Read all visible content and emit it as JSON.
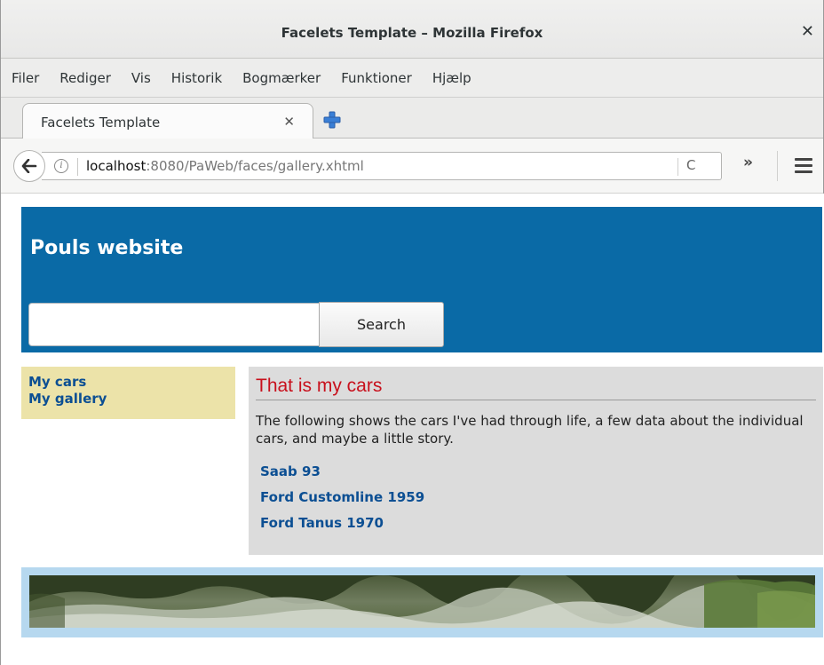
{
  "window": {
    "title": "Facelets Template – Mozilla Firefox"
  },
  "menubar": {
    "items": [
      "Filer",
      "Rediger",
      "Vis",
      "Historik",
      "Bogmærker",
      "Funktioner",
      "Hjælp"
    ]
  },
  "tabs": [
    {
      "label": "Facelets Template"
    }
  ],
  "icons": {
    "close_window": "close-icon",
    "tab_close": "close-icon",
    "new_tab": "plus-icon",
    "back": "arrow-left-icon",
    "info": "info-icon",
    "reload": "reload-icon",
    "overflow": "double-chevron-icon",
    "menu": "hamburger-icon"
  },
  "navbar": {
    "url_host": "localhost",
    "url_rest": ":8080/PaWeb/faces/gallery.xhtml"
  },
  "page": {
    "site_title": "Pouls website",
    "search": {
      "value": "",
      "button_label": "Search"
    },
    "sidenav": [
      "My cars",
      "My gallery"
    ],
    "content": {
      "title": "That is my cars",
      "description": "The following shows the cars I've had through life, a few data about the individual cars, and maybe a little story.",
      "cars": [
        "Saab 93",
        "Ford Customline 1959",
        "Ford Tanus 1970"
      ]
    }
  },
  "colors": {
    "header_bg": "#0a6aa6",
    "sidenav_bg": "#ece3a9",
    "content_bg": "#dcdcdc",
    "content_title": "#c8101c",
    "link": "#0c4f93",
    "footer_bg": "#b6d8ef"
  }
}
